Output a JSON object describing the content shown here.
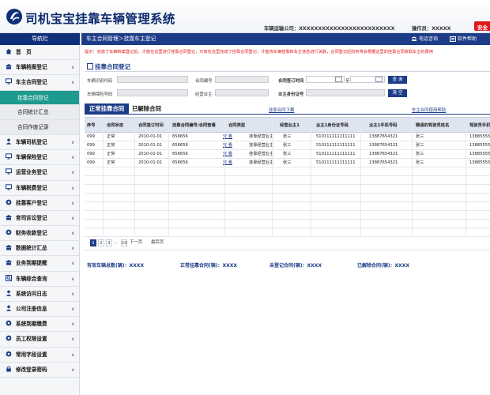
{
  "header": {
    "app_title": "司机宝宝挂靠车辆管理系统",
    "company_label": "车辆运输公司：XXXXXXXXXXXXXXXXXXXXXXXXX",
    "author_label": "操作员：XXXXX",
    "safe_exit_label": "安全",
    "colors": {
      "brand": "#0f2f78",
      "accent": "#1c3c88",
      "danger": "#e01818",
      "active": "#1e9a8e"
    }
  },
  "nav": {
    "title": "导航栏",
    "items": [
      {
        "icon": "home-icon",
        "label": "首　页",
        "chev": ""
      },
      {
        "icon": "archive-icon",
        "label": "车辆档案登记",
        "chev": "∨"
      },
      {
        "icon": "monitor-icon",
        "label": "车主合同登记",
        "chev": "∧"
      },
      {
        "icon": "person-icon",
        "label": "车辆司机登记",
        "chev": "∨"
      },
      {
        "icon": "monitor-icon",
        "label": "车辆保险登记",
        "chev": "∨"
      },
      {
        "icon": "monitor-icon",
        "label": "运营业务登记",
        "chev": "∨"
      },
      {
        "icon": "monitor-icon",
        "label": "车辆税费登记",
        "chev": "∨"
      },
      {
        "icon": "gear-icon",
        "label": "挂靠客户登记",
        "chev": "∨"
      },
      {
        "icon": "archive-icon",
        "label": "官司诉讼登记",
        "chev": "∨"
      },
      {
        "icon": "gear-icon",
        "label": "财务收款登记",
        "chev": "∨"
      },
      {
        "icon": "archive-icon",
        "label": "数据统计汇总",
        "chev": "∨"
      },
      {
        "icon": "archive-icon",
        "label": "业务到期提醒",
        "chev": "∨"
      },
      {
        "icon": "search-icon",
        "label": "车辆综合查询",
        "chev": "∨"
      },
      {
        "icon": "person-icon",
        "label": "系统访问日志",
        "chev": "∨"
      },
      {
        "icon": "person-icon",
        "label": "公司注册信息",
        "chev": "∨"
      },
      {
        "icon": "gear-icon",
        "label": "系统到期缴费",
        "chev": "∨"
      },
      {
        "icon": "gear-icon",
        "label": "员工权限设置",
        "chev": "∨"
      },
      {
        "icon": "gear-icon",
        "label": "常用字段设置",
        "chev": "∨"
      },
      {
        "icon": "lock-icon",
        "label": "修改登录密码",
        "chev": "∨"
      }
    ],
    "sub_items": [
      {
        "label": "挂靠合同登记",
        "active": true
      },
      {
        "label": "合同统计汇总",
        "active": false
      },
      {
        "label": "合同作废记录",
        "active": false
      }
    ]
  },
  "breadcrumb": {
    "text": "车主合同管理＞挂靠车主登记",
    "links": [
      "电话咨询",
      "软件帮助"
    ]
  },
  "notice": "提示：完成了车辆档案登记后，才能在这里进行挂靠合同登记，只有在这里完成了挂靠合同登记，才能将车辆挂靠和车主信息进行关联，合同登记后财务将会根据这里的挂靠合同收取车主的费用",
  "form": {
    "section_title": "挂靠合同登记",
    "plate_label": "车辆识别代码",
    "contract_no_label": "合同编号",
    "date_label": "合同签订时间",
    "date_to_label": "至",
    "owner_phone_label": "车辆保险号码",
    "operator_label": "经营业主",
    "owner_id_label": "业主身份证号",
    "query_button": "查 询",
    "clear_button": "清 空"
  },
  "tabs": {
    "active_label": "正常挂靠合同",
    "ended_label": "已解除合同",
    "download_link": "挂靠合同下载",
    "help_link": "车主合同使用帮助"
  },
  "table": {
    "columns": [
      "序号",
      "合同状态",
      "合同签订时间",
      "挂靠合同编号/合同查看",
      "合同类型",
      "经营业主1",
      "业主1身份证号码",
      "业主1手机号码",
      "聘请的驾驶员姓名",
      "驾驶员手机"
    ],
    "rows": [
      [
        "099",
        "正常",
        "2010-01-01",
        "656656",
        "查 看",
        "挂靠经营业主",
        "张三",
        "510111111111111",
        "13887654321",
        "张三",
        "13885555"
      ],
      [
        "099",
        "正常",
        "2010-01-01",
        "656656",
        "查 看",
        "挂靠经营业主",
        "张三",
        "510111111111111",
        "13887654321",
        "张三",
        "13885555"
      ],
      [
        "099",
        "正常",
        "2010-01-01",
        "656656",
        "查 看",
        "挂靠经营业主",
        "张三",
        "510111111111111",
        "13887654321",
        "张三",
        "13885555"
      ],
      [
        "099",
        "正常",
        "2010-01-01",
        "656656",
        "查 看",
        "挂靠经营业主",
        "张三",
        "510111111111111",
        "13887654321",
        "张三",
        "13885555"
      ]
    ]
  },
  "pager": {
    "pages": [
      "1",
      "2",
      "3"
    ],
    "ellipsis": "…",
    "last_num": "10",
    "next": "下一页",
    "last": "最后页"
  },
  "stats": [
    "有效车辆总数(辆)：XXXX",
    "正常挂靠合同(辆)：XXXX",
    "未登记合同(辆)：XXXX",
    "已解除合同(辆)：XXXX"
  ]
}
